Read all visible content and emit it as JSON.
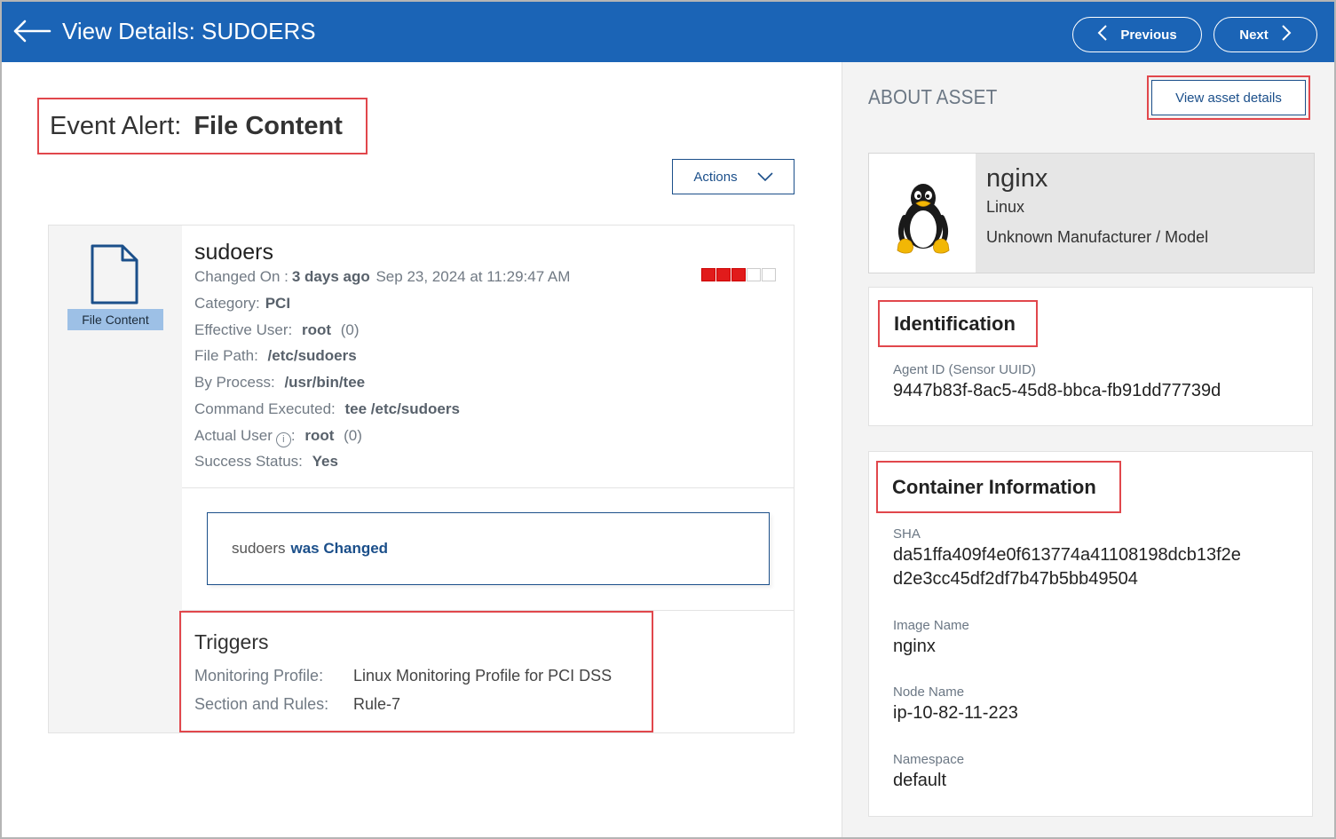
{
  "header": {
    "title": "View Details: SUDOERS",
    "previous_label": "Previous",
    "next_label": "Next"
  },
  "event": {
    "title_prefix": "Event Alert:",
    "title_type": "File Content",
    "actions_label": "Actions",
    "badge": "File Content",
    "file_name": "sudoers",
    "changed_on_label": "Changed On :",
    "changed_on_relative": "3 days ago",
    "changed_on_date": "Sep 23, 2024 at 11:29:47 AM",
    "severity_level": 3,
    "severity_max": 5,
    "category_label": "Category:",
    "category_value": "PCI",
    "effective_user_label": "Effective User:",
    "effective_user_value": "root",
    "effective_user_id": "(0)",
    "file_path_label": "File Path:",
    "file_path_value": "/etc/sudoers",
    "by_process_label": "By Process:",
    "by_process_value": "/usr/bin/tee",
    "command_label": "Command Executed:",
    "command_value": "tee /etc/sudoers",
    "actual_user_label": "Actual User",
    "actual_user_value": "root",
    "actual_user_id": "(0)",
    "success_label": "Success Status:",
    "success_value": "Yes",
    "changed_subject": "sudoers",
    "changed_text": "was Changed"
  },
  "triggers": {
    "title": "Triggers",
    "monitoring_profile_label": "Monitoring Profile:",
    "monitoring_profile_value": "Linux Monitoring Profile for PCI DSS",
    "section_rules_label": "Section and Rules:",
    "section_rules_value": "Rule-7"
  },
  "asset": {
    "section_title": "ABOUT ASSET",
    "view_details_label": "View asset details",
    "name": "nginx",
    "os": "Linux",
    "model": "Unknown Manufacturer / Model"
  },
  "identification": {
    "title": "Identification",
    "agent_id_label": "Agent ID (Sensor UUID)",
    "agent_id_value": "9447b83f-8ac5-45d8-bbca-fb91dd77739d"
  },
  "container": {
    "title": "Container Information",
    "sha_label": "SHA",
    "sha_line1": "da51ffa409f4e0f613774a41108198dcb13f2e",
    "sha_line2": "d2e3cc45df2df7b47b5bb49504",
    "image_name_label": "Image Name",
    "image_name_value": "nginx",
    "node_name_label": "Node Name",
    "node_name_value": "ip-10-82-11-223",
    "namespace_label": "Namespace",
    "namespace_value": "default"
  },
  "colors": {
    "header_bg": "#1b64b6",
    "accent": "#1b4f8a",
    "highlight_outline": "#e1474c",
    "severity_on": "#e11b1b"
  }
}
